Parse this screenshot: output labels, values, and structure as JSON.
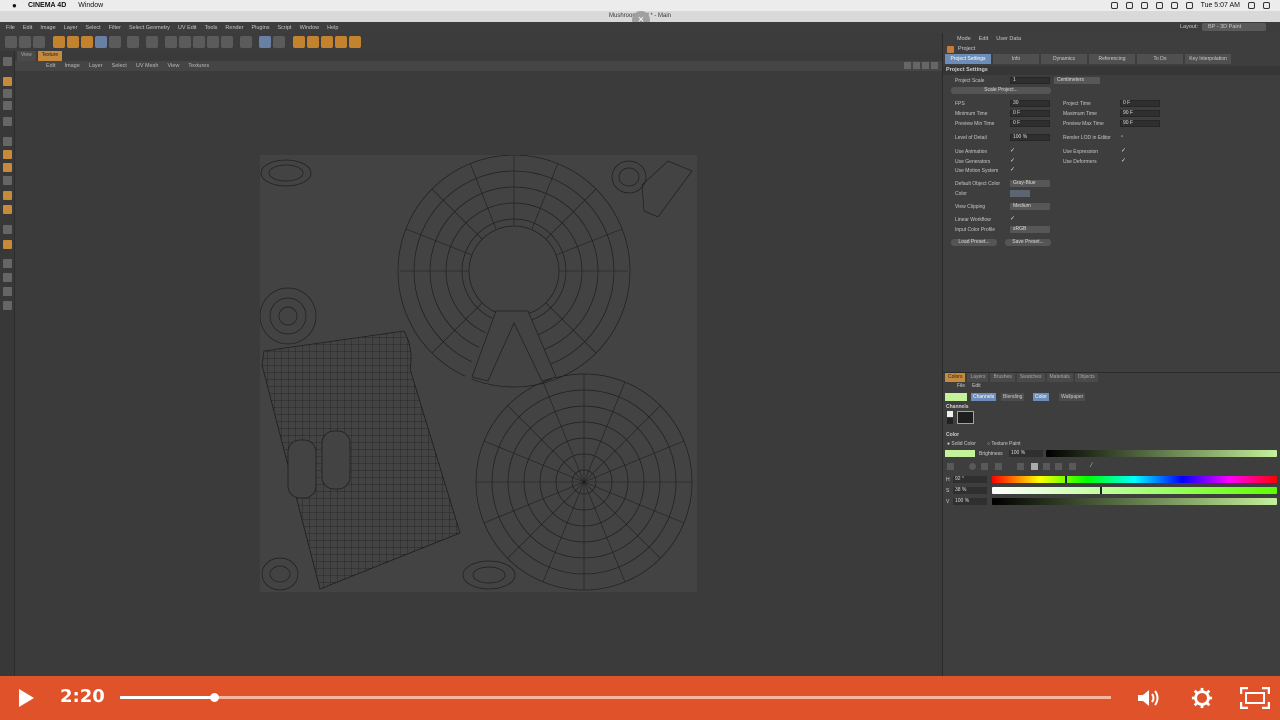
{
  "mac_menubar": {
    "app_name": "CINEMA 4D",
    "menu_window": "Window",
    "clock": "Tue 5:07 AM"
  },
  "window_title": "Mushroom.c4d * - Main",
  "c4d_menu": [
    "File",
    "Edit",
    "Image",
    "Layer",
    "Select",
    "Filter",
    "Select Geometry",
    "UV Edit",
    "Tools",
    "Render",
    "Plugins",
    "Script",
    "Window",
    "Help"
  ],
  "layout": {
    "label": "Layout:",
    "value": "BP - 3D Paint"
  },
  "view_tabs": [
    "View",
    "Texture"
  ],
  "view_menu": [
    "Edit",
    "Image",
    "Layer",
    "Select",
    "UV Mesh",
    "View",
    "Textures"
  ],
  "attributes": {
    "menu": [
      "Mode",
      "Edit",
      "User Data"
    ],
    "title": "Project",
    "tabs": [
      "Project Settings",
      "Info",
      "Dynamics",
      "Referencing",
      "To Do",
      "Key Interpolation"
    ],
    "section": "Project Settings",
    "project_scale_label": "Project Scale",
    "project_scale_value": "1",
    "project_scale_unit": "Centimeters",
    "scale_project_btn": "Scale Project...",
    "fps_label": "FPS",
    "fps_value": "30",
    "project_time_label": "Project Time",
    "project_time_value": "0 F",
    "min_time_label": "Minimum Time",
    "min_time_value": "0 F",
    "max_time_label": "Maximum Time",
    "max_time_value": "90 F",
    "preview_min_label": "Preview Min Time",
    "preview_min_value": "0 F",
    "preview_max_label": "Preview Max Time",
    "preview_max_value": "90 F",
    "lod_label": "Level of Detail",
    "lod_value": "100 %",
    "render_lod_label": "Render LOD in Editor",
    "use_animation_label": "Use Animation",
    "use_expression_label": "Use Expression",
    "use_generators_label": "Use Generators",
    "use_deformers_label": "Use Deformers",
    "use_motion_label": "Use Motion System",
    "default_obj_color_label": "Default Object Color",
    "default_obj_color_value": "Gray-Blue",
    "color_label": "Color",
    "view_clipping_label": "View Clipping",
    "view_clipping_value": "Medium",
    "linear_workflow_label": "Linear Workflow",
    "input_color_profile_label": "Input Color Profile",
    "input_color_profile_value": "sRGB",
    "load_preset_btn": "Load Preset...",
    "save_preset_btn": "Save Preset..."
  },
  "color_manager": {
    "tabs": [
      "Colors",
      "Layers",
      "Brushes",
      "Swatches",
      "Materials",
      "Objects"
    ],
    "menu": [
      "File",
      "Edit"
    ],
    "sub_tabs": [
      "Channels",
      "Blending",
      "Color",
      "Wallpaper"
    ],
    "channels_label": "Channels",
    "color_label": "Color",
    "solid_color": "Solid Color",
    "texture_paint": "Texture Paint",
    "brightness_label": "Brightness",
    "brightness_value": "100 %",
    "h_label": "H",
    "h_value": "92 °",
    "s_label": "S",
    "s_value": "38 %",
    "v_label": "V",
    "v_value": "100 %",
    "current_color": "#c4f29a"
  },
  "video": {
    "time": "2:20",
    "progress": 0.095
  }
}
